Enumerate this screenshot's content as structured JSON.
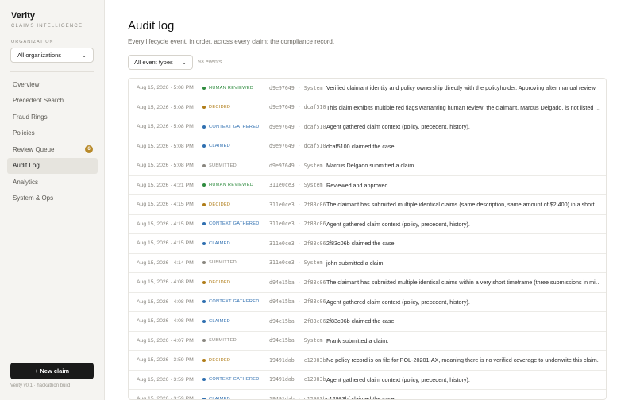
{
  "brand": {
    "name": "Verity",
    "subtitle": "CLAIMS INTELLIGENCE"
  },
  "org": {
    "label": "ORGANIZATION",
    "selected": "All organizations"
  },
  "nav": {
    "items": [
      {
        "label": "Overview",
        "active": false,
        "badge": ""
      },
      {
        "label": "Precedent Search",
        "active": false,
        "badge": ""
      },
      {
        "label": "Fraud Rings",
        "active": false,
        "badge": ""
      },
      {
        "label": "Policies",
        "active": false,
        "badge": ""
      },
      {
        "label": "Review Queue",
        "active": false,
        "badge": "6"
      },
      {
        "label": "Audit Log",
        "active": true,
        "badge": ""
      },
      {
        "label": "Analytics",
        "active": false,
        "badge": ""
      },
      {
        "label": "System & Ops",
        "active": false,
        "badge": ""
      }
    ]
  },
  "sidebar_footer": {
    "new_claim": "+ New claim",
    "version": "Verity v0.1 · hackathon build"
  },
  "page": {
    "title": "Audit log",
    "subtitle": "Every lifecycle event, in order, across every claim: the compliance record.",
    "filter": "All event types",
    "count": "93 events"
  },
  "colors": {
    "HUMAN REVIEWED": "#2e8b3e",
    "DECIDED": "#b07d18",
    "CONTEXT GATHERED": "#2f6fb0",
    "CLAIMED": "#2f6fb0",
    "SUBMITTED": "#8a8780"
  },
  "rows": [
    {
      "time": "Aug 15, 2026 · 5:08 PM",
      "type": "HUMAN REVIEWED",
      "actor": "d9e97649 · System",
      "message": "Verified claimant identity and policy ownership directly with the policyholder. Approving after manual review."
    },
    {
      "time": "Aug 15, 2026 · 5:08 PM",
      "type": "DECIDED",
      "actor": "d9e97649 · dcaf5100",
      "message": "This claim exhibits multiple red flags warranting human review: the claimant, Marcus Delgado, is not listed on the policy."
    },
    {
      "time": "Aug 15, 2026 · 5:08 PM",
      "type": "CONTEXT GATHERED",
      "actor": "d9e97649 · dcaf5100",
      "message": "Agent gathered claim context (policy, precedent, history)."
    },
    {
      "time": "Aug 15, 2026 · 5:08 PM",
      "type": "CLAIMED",
      "actor": "d9e97649 · dcaf5100",
      "message": "dcaf5100 claimed the case."
    },
    {
      "time": "Aug 15, 2026 · 5:08 PM",
      "type": "SUBMITTED",
      "actor": "d9e97649 · System",
      "message": "Marcus Delgado submitted a claim."
    },
    {
      "time": "Aug 15, 2026 · 4:21 PM",
      "type": "HUMAN REVIEWED",
      "actor": "311e0ce3 · System",
      "message": "Reviewed and approved."
    },
    {
      "time": "Aug 15, 2026 · 4:15 PM",
      "type": "DECIDED",
      "actor": "311e0ce3 · 2f83c06b",
      "message": "The claimant has submitted multiple identical claims (same description, same amount of $2,400) in a short period."
    },
    {
      "time": "Aug 15, 2026 · 4:15 PM",
      "type": "CONTEXT GATHERED",
      "actor": "311e0ce3 · 2f83c06b",
      "message": "Agent gathered claim context (policy, precedent, history)."
    },
    {
      "time": "Aug 15, 2026 · 4:15 PM",
      "type": "CLAIMED",
      "actor": "311e0ce3 · 2f83c06b",
      "message": "2f83c06b claimed the case."
    },
    {
      "time": "Aug 15, 2026 · 4:14 PM",
      "type": "SUBMITTED",
      "actor": "311e0ce3 · System",
      "message": "john submitted a claim."
    },
    {
      "time": "Aug 15, 2026 · 4:08 PM",
      "type": "DECIDED",
      "actor": "d94e15ba · 2f83c06b",
      "message": "The claimant has submitted multiple identical claims within a very short timeframe (three submissions in minutes)."
    },
    {
      "time": "Aug 15, 2026 · 4:08 PM",
      "type": "CONTEXT GATHERED",
      "actor": "d94e15ba · 2f83c06b",
      "message": "Agent gathered claim context (policy, precedent, history)."
    },
    {
      "time": "Aug 15, 2026 · 4:08 PM",
      "type": "CLAIMED",
      "actor": "d94e15ba · 2f83c06b",
      "message": "2f83c06b claimed the case."
    },
    {
      "time": "Aug 15, 2026 · 4:07 PM",
      "type": "SUBMITTED",
      "actor": "d94e15ba · System",
      "message": "Frank submitted a claim."
    },
    {
      "time": "Aug 15, 2026 · 3:59 PM",
      "type": "DECIDED",
      "actor": "19491dab · c12983bf",
      "message": "No policy record is on file for POL-20201-AX, meaning there is no verified coverage to underwrite this claim."
    },
    {
      "time": "Aug 15, 2026 · 3:59 PM",
      "type": "CONTEXT GATHERED",
      "actor": "19491dab · c12983bf",
      "message": "Agent gathered claim context (policy, precedent, history)."
    },
    {
      "time": "Aug 15, 2026 · 3:59 PM",
      "type": "CLAIMED",
      "actor": "19491dab · c12983bf",
      "message": "c12983bf claimed the case."
    }
  ]
}
